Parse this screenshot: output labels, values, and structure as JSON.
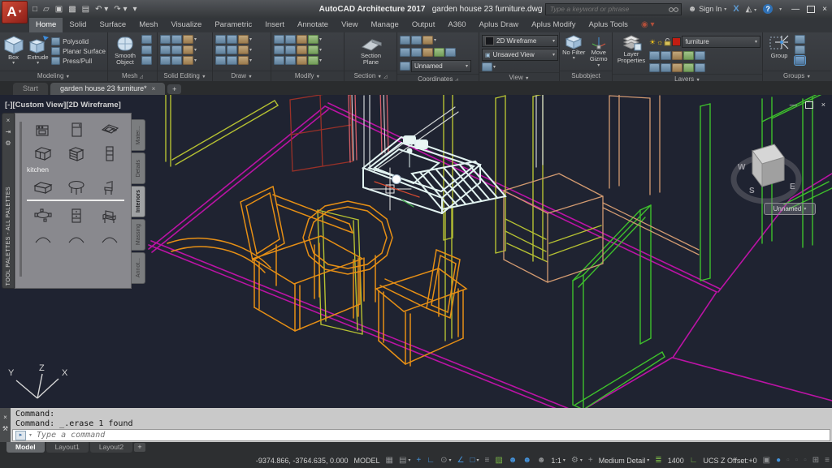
{
  "title_bar": {
    "app_title": "AutoCAD Architecture 2017",
    "doc_title": "garden house 23 furniture.dwg",
    "search_placeholder": "Type a keyword or phrase",
    "sign_in_label": "Sign In",
    "qat_icons": [
      {
        "name": "new-icon",
        "glyph": "□"
      },
      {
        "name": "open-icon",
        "glyph": "▱"
      },
      {
        "name": "save-icon",
        "glyph": "▣"
      },
      {
        "name": "saveas-icon",
        "glyph": "▩"
      },
      {
        "name": "plot-icon",
        "glyph": "▤"
      },
      {
        "name": "undo-icon",
        "glyph": "↶ ▾"
      },
      {
        "name": "redo-icon",
        "glyph": "↷ ▾"
      },
      {
        "name": "qat-menu-icon",
        "glyph": "▾"
      }
    ]
  },
  "ribbon": {
    "tabs": [
      {
        "label": "Home",
        "active": true
      },
      {
        "label": "Solid"
      },
      {
        "label": "Surface"
      },
      {
        "label": "Mesh"
      },
      {
        "label": "Visualize"
      },
      {
        "label": "Parametric"
      },
      {
        "label": "Insert"
      },
      {
        "label": "Annotate"
      },
      {
        "label": "View"
      },
      {
        "label": "Manage"
      },
      {
        "label": "Output"
      },
      {
        "label": "A360"
      },
      {
        "label": "Aplus Draw"
      },
      {
        "label": "Aplus Modify"
      },
      {
        "label": "Aplus Tools"
      }
    ],
    "panels": {
      "modeling": {
        "label": "Modeling",
        "box": "Box",
        "extrude": "Extrude",
        "items": [
          "Polysolid",
          "Planar Surface",
          "Press/Pull"
        ]
      },
      "mesh": {
        "label": "Mesh",
        "smooth": "Smooth Object"
      },
      "solid_editing": {
        "label": "Solid Editing"
      },
      "draw": {
        "label": "Draw"
      },
      "modify": {
        "label": "Modify"
      },
      "section": {
        "label": "Section",
        "plane": "Section Plane"
      },
      "coordinates": {
        "label": "Coordinates",
        "ucs_name": "Unnamed"
      },
      "view": {
        "label": "View",
        "visual_style": "2D Wireframe",
        "view_name": "Unsaved View"
      },
      "subobject": {
        "label": "Subobject",
        "filter": "No Filter",
        "gizmo": "Move Gizmo"
      },
      "layers": {
        "label": "Layers",
        "properties": "Layer Properties",
        "current_layer": "furniture",
        "layer_color": "#c21d12"
      },
      "groups": {
        "label": "Groups",
        "group": "Group"
      }
    }
  },
  "file_tabs": {
    "tabs": [
      {
        "label": "Start",
        "active": false,
        "closable": false
      },
      {
        "label": "garden house 23 furniture*",
        "active": true,
        "closable": true
      }
    ]
  },
  "viewport": {
    "label_parts": [
      "[-]",
      "[Custom View]",
      "[2D Wireframe]"
    ],
    "viewcube": {
      "compass_letters": [
        "W",
        "S",
        "E"
      ],
      "view_name": "Unnamed"
    }
  },
  "palette": {
    "title": "TOOL PALETTES - ALL PALETTES",
    "tabs": [
      {
        "label": "Mater...",
        "active": false
      },
      {
        "label": "Details",
        "active": false
      },
      {
        "label": "Interiors",
        "active": true
      },
      {
        "label": "Massing",
        "active": false
      },
      {
        "label": "Annot...",
        "active": false
      }
    ],
    "groups": [
      {
        "items": [
          "range",
          "refrigerator",
          "sink",
          "base-cabinet",
          "drawer-unit",
          "wall-cabinet"
        ],
        "label": "kitchen"
      },
      {
        "items": [
          "sideboard",
          "round-table",
          "side-chair"
        ],
        "divider_after": true
      },
      {
        "items": [
          "dining-set",
          "file-cabinet",
          "armchair"
        ]
      },
      {
        "items": [
          "arc",
          "arc",
          "arc"
        ]
      }
    ]
  },
  "command": {
    "history": [
      "Command:",
      "Command: _.erase 1 found"
    ],
    "placeholder": "Type a command"
  },
  "layout_tabs": [
    {
      "label": "Model",
      "active": true
    },
    {
      "label": "Layout1",
      "active": false
    },
    {
      "label": "Layout2",
      "active": false
    }
  ],
  "status_bar": {
    "items": [
      {
        "name": "coordinates-readout",
        "type": "text",
        "label": "-9374.866, -3764.635, 0.000"
      },
      {
        "name": "model-space-button",
        "type": "text",
        "label": "MODEL"
      },
      {
        "name": "grid-display-icon",
        "type": "icon",
        "glyph": "▦",
        "state": "off"
      },
      {
        "name": "snap-mode-icon",
        "type": "icon",
        "glyph": "▤",
        "state": "off",
        "caret": true
      },
      {
        "name": "dynamic-input-icon",
        "type": "icon",
        "glyph": "+",
        "state": "on"
      },
      {
        "name": "ortho-mode-icon",
        "type": "icon",
        "glyph": "∟",
        "state": "on"
      },
      {
        "name": "polar-tracking-icon",
        "type": "icon",
        "glyph": "⊙",
        "state": "off",
        "caret": true
      },
      {
        "name": "isometric-drafting-icon",
        "type": "icon",
        "glyph": "∠",
        "state": "on"
      },
      {
        "name": "object-snap-icon",
        "type": "icon",
        "glyph": "□",
        "state": "on",
        "caret": true
      },
      {
        "name": "lineweight-icon",
        "type": "icon",
        "glyph": "≡",
        "state": "off"
      },
      {
        "name": "transparency-icon",
        "type": "icon",
        "glyph": "▨",
        "state": "green"
      },
      {
        "name": "annotation-visibility-icon",
        "type": "icon",
        "glyph": "☻",
        "state": "on"
      },
      {
        "name": "annotation-autoscale-icon",
        "type": "icon",
        "glyph": "☻",
        "state": "on"
      },
      {
        "name": "annotation-scale-icon",
        "type": "icon",
        "glyph": "☻",
        "state": "off"
      },
      {
        "name": "annotation-scale-value",
        "type": "text",
        "label": "1:1",
        "caret": true
      },
      {
        "name": "workspace-switching-icon",
        "type": "icon",
        "glyph": "⚙",
        "state": "off",
        "caret": true
      },
      {
        "name": "annotation-monitor-plus-icon",
        "type": "icon",
        "glyph": "+",
        "state": "off"
      },
      {
        "name": "detail-level-value",
        "type": "text",
        "label": "Medium Detail",
        "caret": true
      },
      {
        "name": "layer-stack-icon",
        "type": "icon",
        "glyph": "≣",
        "state": "green"
      },
      {
        "name": "scale-list-value",
        "type": "text",
        "label": "1400"
      },
      {
        "name": "ucs-indicator-icon",
        "type": "icon",
        "glyph": "∟",
        "state": "ucs"
      },
      {
        "name": "ucs-offset-readout",
        "type": "text",
        "label": "UCS Z Offset:+0"
      },
      {
        "name": "isolate-objects-icon",
        "type": "icon",
        "glyph": "▣",
        "state": "off"
      },
      {
        "name": "hardware-acceleration-icon",
        "type": "icon",
        "glyph": "●",
        "state": "on"
      },
      {
        "name": "disabled-icon-1",
        "type": "icon",
        "glyph": "▫",
        "state": "dim"
      },
      {
        "name": "disabled-icon-2",
        "type": "icon",
        "glyph": "▫",
        "state": "dim"
      },
      {
        "name": "disabled-icon-3",
        "type": "icon",
        "glyph": "▫",
        "state": "dim"
      },
      {
        "name": "clean-screen-icon",
        "type": "icon",
        "glyph": "⊞",
        "state": "off"
      },
      {
        "name": "customize-icon",
        "type": "icon",
        "glyph": "≡",
        "state": "off"
      }
    ]
  },
  "canvas_colors": {
    "background": "#1f2331",
    "magenta": "#bb13a5",
    "green": "#3ec02c",
    "yellow_green": "#b5c032",
    "orange": "#e68f15",
    "salmon": "#d29a70",
    "maroon": "#993128",
    "pink": "#d55e68",
    "white_struct": "#cfd3d4",
    "selection_white": "#e2f3f1",
    "crosshair": "#e8e8e8"
  }
}
